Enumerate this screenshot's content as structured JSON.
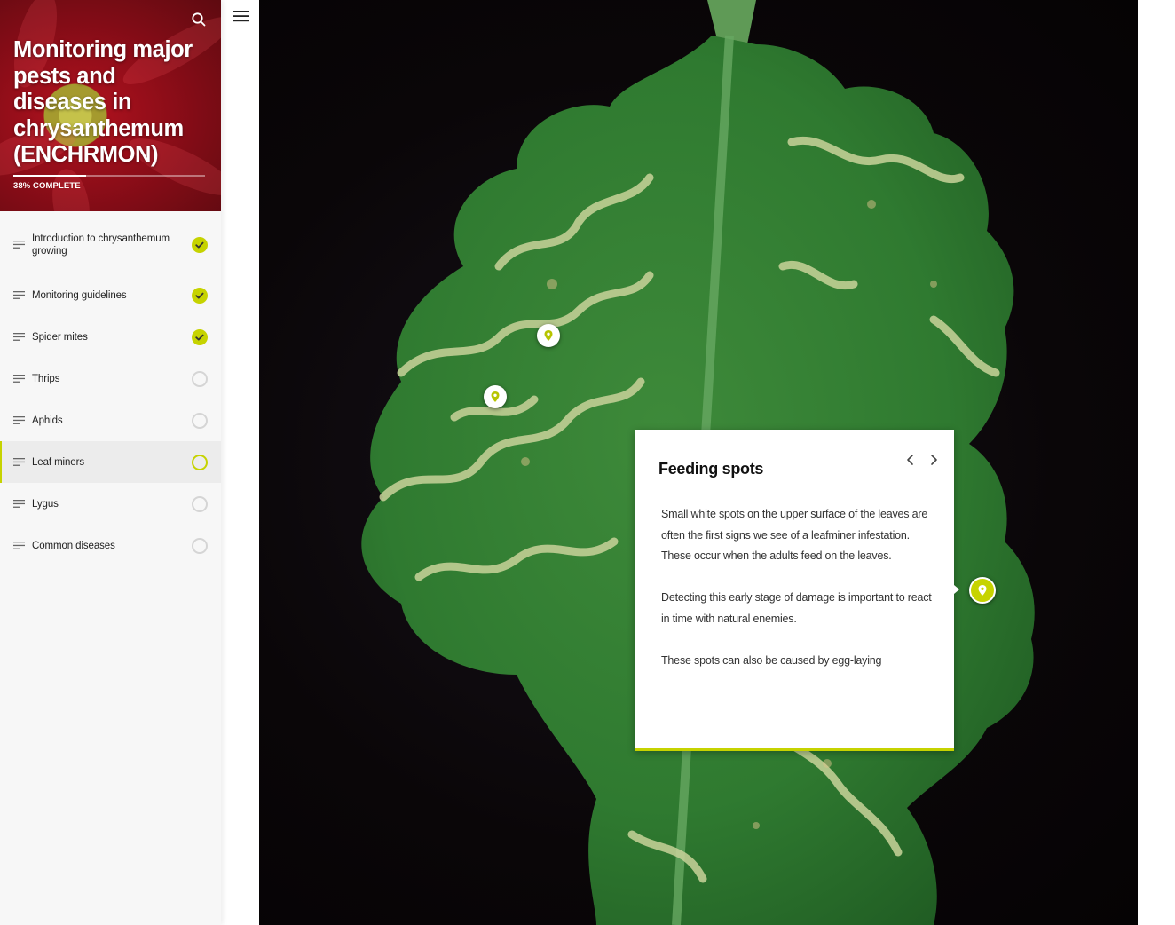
{
  "course": {
    "title": "Monitoring major pests and diseases in chrysanthemum (ENCHRMON)",
    "progress_label": "38% COMPLETE",
    "progress_fraction": 0.38
  },
  "icons": {
    "search": "search-icon",
    "menu": "hamburger-menu-icon",
    "lesson": "lesson-lines-icon",
    "done": "checkmark-icon",
    "marker": "map-pin-icon"
  },
  "colors": {
    "accent": "#c6d300",
    "hero": "#b3121f"
  },
  "sidebar": {
    "items": [
      {
        "label": "Introduction to chrysanthemum growing",
        "status": "done"
      },
      {
        "label": "Monitoring guidelines",
        "status": "done"
      },
      {
        "label": "Spider mites",
        "status": "done"
      },
      {
        "label": "Thrips",
        "status": "todo"
      },
      {
        "label": "Aphids",
        "status": "todo"
      },
      {
        "label": "Leaf miners",
        "status": "current"
      },
      {
        "label": "Lygus",
        "status": "todo"
      },
      {
        "label": "Common diseases",
        "status": "todo"
      }
    ]
  },
  "popup": {
    "title": "Feeding spots",
    "paragraphs": [
      "Small white spots on the upper surface of the leaves are often the first signs we see of a leafminer infestation. These occur when the adults feed on the leaves.",
      "Detecting this early stage of damage is important to react in time with natural enemies.",
      "These spots can also be caused by egg-laying"
    ]
  }
}
